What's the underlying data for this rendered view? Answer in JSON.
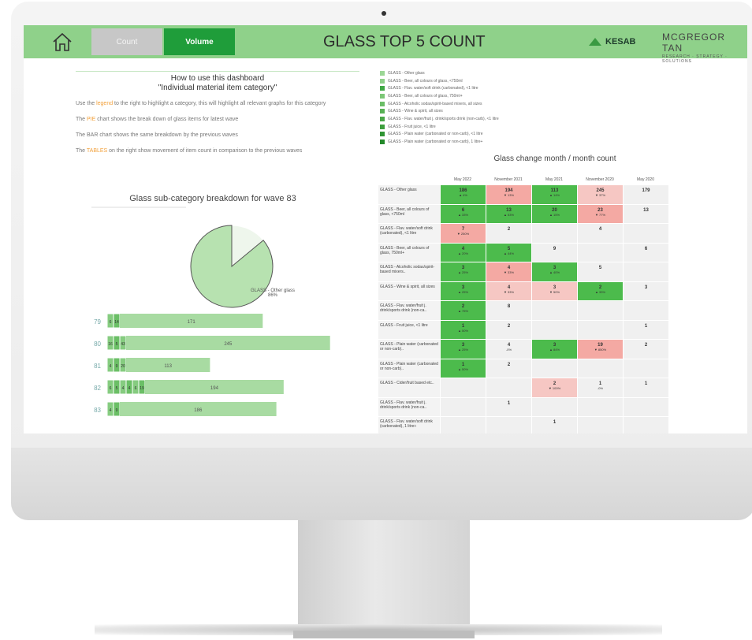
{
  "header": {
    "count_label": "Count",
    "volume_label": "Volume",
    "title": "GLASS TOP 5 COUNT",
    "kesab_logo": "KESAB",
    "mcgregor_logo": "MCGREGOR TAN",
    "mcgregor_tagline": "RESEARCH · STRATEGY · SOLUTIONS"
  },
  "howto": {
    "title_line1": "How to use this dashboard",
    "title_line2": "\"Individual material item category\"",
    "line1_pre": "Use the ",
    "line1_hl": "legend",
    "line1_post": " to the right to highlight a category, this will highlight all relevant graphs for this category",
    "line2_pre": "The ",
    "line2_hl": "PIE",
    "line2_post": " chart shows the break down of glass items for latest wave",
    "line3": "The BAR chart shows the same breakdown by the previous waves",
    "line4_pre": "The ",
    "line4_hl": "TABLES",
    "line4_post": " on the right show movement of item count in comparison to the previous waves"
  },
  "pie": {
    "title": "Glass sub-category breakdown for wave 83",
    "label_name": "GLASS - Other glass",
    "label_pct": "86%",
    "main_fraction": 0.86
  },
  "bars": {
    "rows": [
      {
        "wave": "79",
        "small": [
          "6",
          "14"
        ],
        "main": "171"
      },
      {
        "wave": "80",
        "small": [
          "16",
          "5",
          "43"
        ],
        "main": "245"
      },
      {
        "wave": "81",
        "small": [
          "4",
          "9",
          "20"
        ],
        "main": "113"
      },
      {
        "wave": "82",
        "small": [
          "6",
          "5",
          "4",
          "4",
          "6",
          "19"
        ],
        "main": "194"
      },
      {
        "wave": "83",
        "small": [
          "4",
          "9"
        ],
        "main": "186"
      }
    ],
    "totals": [
      171,
      245,
      113,
      194,
      186
    ]
  },
  "legend": [
    {
      "label": "GLASS - Other glass",
      "color": "#9bd695"
    },
    {
      "label": "GLASS - Beer, all colours of glass, <750ml",
      "color": "#8fd08a"
    },
    {
      "label": "GLASS - Flav. water/soft drink (carbonated), <1 litre",
      "color": "#3fa845"
    },
    {
      "label": "GLASS - Beer, all colours of glass, 750ml+",
      "color": "#7cc777"
    },
    {
      "label": "GLASS - Alcoholic sodas/spirit-based mixers, all sizes",
      "color": "#6abd66"
    },
    {
      "label": "GLASS - Wine & spirit, all sizes",
      "color": "#58b155"
    },
    {
      "label": "GLASS - Flav. water/fruit j. drink/sports drink (non-carb), <1 litre",
      "color": "#4aa748"
    },
    {
      "label": "GLASS - Fruit juice, <1 litre",
      "color": "#3d9e3d"
    },
    {
      "label": "GLASS - Plain water (carbonated or non-carb), <1 litre",
      "color": "#2f9433"
    },
    {
      "label": "GLASS - Plain water (carbonated or non-carb), 1 litre+",
      "color": "#23892a"
    }
  ],
  "heatmap": {
    "title": "Glass change month / month count",
    "columns": [
      "May 2022",
      "November 2021",
      "May 2021",
      "November 2020",
      "May 2020"
    ],
    "rows": [
      {
        "label": "GLASS - Other glass",
        "cells": [
          {
            "v": "186",
            "p": "▲ 4%",
            "c": "g"
          },
          {
            "v": "194",
            "p": "▼ 13%",
            "c": "r"
          },
          {
            "v": "113",
            "p": "▲ 14%",
            "c": "g"
          },
          {
            "v": "245",
            "p": "▼ 37%",
            "c": "rl"
          },
          {
            "v": "179",
            "p": "",
            "c": ""
          }
        ]
      },
      {
        "label": "GLASS - Beer, all colours of glass, <750ml",
        "cells": [
          {
            "v": "6",
            "p": "▲ 33%",
            "c": "g"
          },
          {
            "v": "13",
            "p": "▲ 53%",
            "c": "g"
          },
          {
            "v": "20",
            "p": "▲ 15%",
            "c": "g"
          },
          {
            "v": "23",
            "p": "▼ 77%",
            "c": "r"
          },
          {
            "v": "13",
            "p": "",
            "c": ""
          }
        ]
      },
      {
        "label": "GLASS - Flav. water/soft drink (carbonated), <1 litre",
        "cells": [
          {
            "v": "7",
            "p": "▼ 250%",
            "c": "r"
          },
          {
            "v": "2",
            "p": "",
            "c": ""
          },
          {
            "v": "",
            "p": "",
            "c": ""
          },
          {
            "v": "4",
            "p": "",
            "c": ""
          },
          {
            "v": "",
            "p": "",
            "c": ""
          }
        ]
      },
      {
        "label": "GLASS - Beer, all colours of glass, 750ml+",
        "cells": [
          {
            "v": "4",
            "p": "▲ 20%",
            "c": "g"
          },
          {
            "v": "5",
            "p": "▲ 44%",
            "c": "g"
          },
          {
            "v": "9",
            "p": "",
            "c": ""
          },
          {
            "v": "",
            "p": "",
            "c": ""
          },
          {
            "v": "6",
            "p": "",
            "c": ""
          }
        ]
      },
      {
        "label": "GLASS - Alcoholic sodas/spirit-based mixers..",
        "cells": [
          {
            "v": "3",
            "p": "▲ 25%",
            "c": "g"
          },
          {
            "v": "4",
            "p": "▼ 33%",
            "c": "r"
          },
          {
            "v": "3",
            "p": "▲ 40%",
            "c": "g"
          },
          {
            "v": "5",
            "p": "",
            "c": ""
          },
          {
            "v": "",
            "p": "",
            "c": ""
          }
        ]
      },
      {
        "label": "GLASS - Wine & spirit, all sizes",
        "cells": [
          {
            "v": "3",
            "p": "▲ 25%",
            "c": "g"
          },
          {
            "v": "4",
            "p": "▼ 33%",
            "c": "rl"
          },
          {
            "v": "3",
            "p": "▼ 50%",
            "c": "rl"
          },
          {
            "v": "2",
            "p": "▲ 33%",
            "c": "g"
          },
          {
            "v": "3",
            "p": "",
            "c": ""
          }
        ]
      },
      {
        "label": "GLASS - Flav. water/fruit j. drink/sports drink (non-ca..",
        "cells": [
          {
            "v": "2",
            "p": "▲ 75%",
            "c": "g"
          },
          {
            "v": "8",
            "p": "",
            "c": ""
          },
          {
            "v": "",
            "p": "",
            "c": ""
          },
          {
            "v": "",
            "p": "",
            "c": ""
          },
          {
            "v": "",
            "p": "",
            "c": ""
          }
        ]
      },
      {
        "label": "GLASS - Fruit juice, <1 litre",
        "cells": [
          {
            "v": "1",
            "p": "▲ 50%",
            "c": "g"
          },
          {
            "v": "2",
            "p": "",
            "c": ""
          },
          {
            "v": "",
            "p": "",
            "c": ""
          },
          {
            "v": "",
            "p": "",
            "c": ""
          },
          {
            "v": "1",
            "p": "",
            "c": ""
          }
        ]
      },
      {
        "label": "GLASS - Plain water (carbonated or non-carb)..",
        "cells": [
          {
            "v": "3",
            "p": "▲ 25%",
            "c": "g"
          },
          {
            "v": "4",
            "p": "-0%",
            "c": ""
          },
          {
            "v": "3",
            "p": "▲ 84%",
            "c": "g"
          },
          {
            "v": "19",
            "p": "▼ 850%",
            "c": "r"
          },
          {
            "v": "2",
            "p": "",
            "c": ""
          }
        ]
      },
      {
        "label": "GLASS - Plain water (carbonated or non-carb)..",
        "cells": [
          {
            "v": "1",
            "p": "▲ 50%",
            "c": "g"
          },
          {
            "v": "2",
            "p": "",
            "c": ""
          },
          {
            "v": "",
            "p": "",
            "c": ""
          },
          {
            "v": "",
            "p": "",
            "c": ""
          },
          {
            "v": "",
            "p": "",
            "c": ""
          }
        ]
      },
      {
        "label": "GLASS - Cider/fruit based etc..",
        "cells": [
          {
            "v": "",
            "p": "",
            "c": ""
          },
          {
            "v": "",
            "p": "",
            "c": ""
          },
          {
            "v": "2",
            "p": "▼ 100%",
            "c": "rl"
          },
          {
            "v": "1",
            "p": "-0%",
            "c": ""
          },
          {
            "v": "1",
            "p": "",
            "c": ""
          }
        ]
      },
      {
        "label": "GLASS - Flav. water/fruit j. drink/sports drink (non-ca..",
        "cells": [
          {
            "v": "",
            "p": "",
            "c": ""
          },
          {
            "v": "1",
            "p": "",
            "c": ""
          },
          {
            "v": "",
            "p": "",
            "c": ""
          },
          {
            "v": "",
            "p": "",
            "c": ""
          },
          {
            "v": "",
            "p": "",
            "c": ""
          }
        ]
      },
      {
        "label": "GLASS - Flav. water/soft drink (carbonated), 1 litre+",
        "cells": [
          {
            "v": "",
            "p": "",
            "c": ""
          },
          {
            "v": "",
            "p": "",
            "c": ""
          },
          {
            "v": "1",
            "p": "",
            "c": ""
          },
          {
            "v": "",
            "p": "",
            "c": ""
          },
          {
            "v": "",
            "p": "",
            "c": ""
          }
        ]
      }
    ]
  }
}
